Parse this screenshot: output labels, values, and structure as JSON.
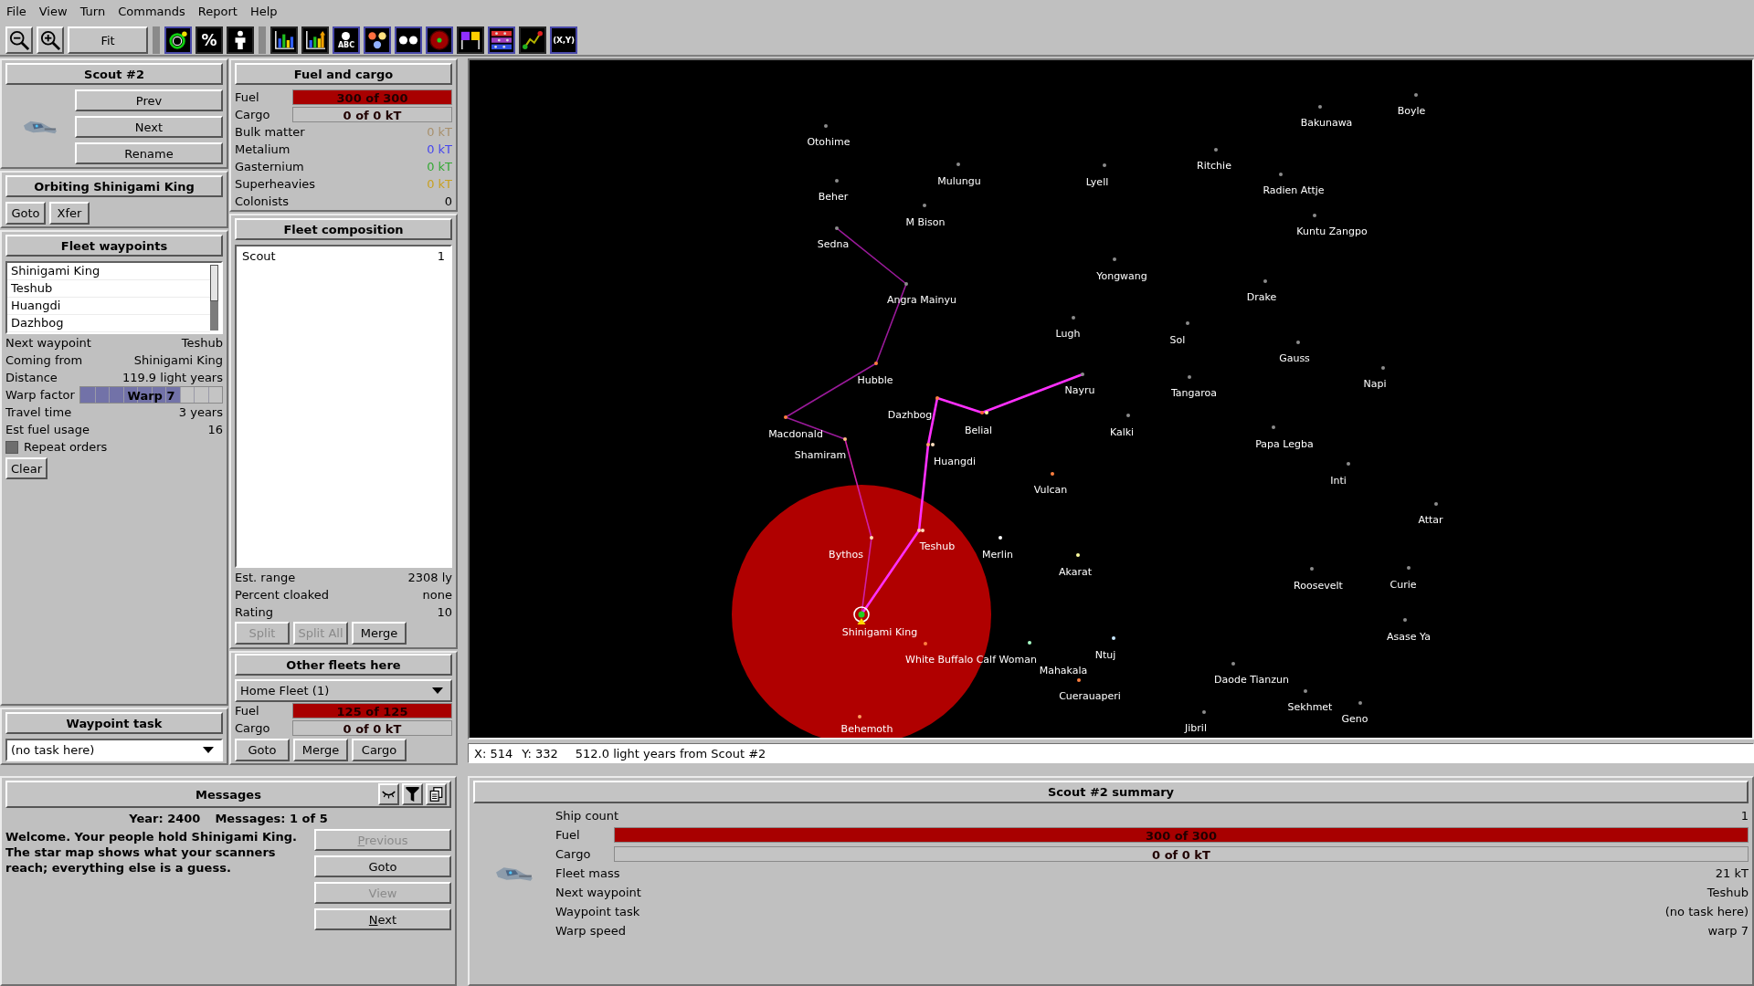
{
  "menu": [
    "File",
    "View",
    "Turn",
    "Commands",
    "Report",
    "Help"
  ],
  "toolbar": [
    {
      "kind": "zoom_out"
    },
    {
      "kind": "zoom_in"
    },
    {
      "kind": "fit",
      "label": "Fit"
    },
    {
      "kind": "separator"
    },
    {
      "kind": "planets",
      "on": true
    },
    {
      "kind": "percent",
      "label": "%",
      "on": false
    },
    {
      "kind": "person",
      "on": false
    },
    {
      "kind": "separator"
    },
    {
      "kind": "bars",
      "on": false
    },
    {
      "kind": "bars_up",
      "on": false
    },
    {
      "kind": "labels",
      "label": "ABC",
      "on": true
    },
    {
      "kind": "colors",
      "on": true
    },
    {
      "kind": "dots",
      "on": true
    },
    {
      "kind": "scanner",
      "on": true
    },
    {
      "kind": "flags",
      "on": false
    },
    {
      "kind": "lanes",
      "on": true
    },
    {
      "kind": "graph",
      "on": false
    },
    {
      "kind": "coords",
      "label": "(X,Y)",
      "on": true
    }
  ],
  "fleet": {
    "title": "Scout #2",
    "buttons": [
      "Prev",
      "Next",
      "Rename"
    ]
  },
  "location": {
    "title": "Orbiting Shinigami King",
    "buttons": [
      "Goto",
      "Xfer"
    ]
  },
  "waypoints": {
    "title": "Fleet waypoints",
    "items": [
      {
        "name": "Shinigami King",
        "selected": false
      },
      {
        "name": "Teshub",
        "selected": false
      },
      {
        "name": "Huangdi",
        "selected": false
      },
      {
        "name": "Dazhbog",
        "selected": false
      }
    ],
    "details": [
      {
        "kind": "text",
        "label": "Next waypoint",
        "value": "Teshub"
      },
      {
        "kind": "text",
        "label": "Coming from",
        "value": "Shinigami King"
      },
      {
        "kind": "text",
        "label": "Distance",
        "value": "119.9 light years"
      },
      {
        "kind": "slider",
        "label": "Warp factor",
        "value": "Warp 7",
        "level": 0.7
      },
      {
        "kind": "text",
        "label": "Travel time",
        "value": "3 years"
      },
      {
        "kind": "text",
        "label": "Est fuel usage",
        "value": "16"
      }
    ],
    "repeat": {
      "label": "Repeat orders",
      "checked": false
    },
    "clear": "Clear"
  },
  "waypoint_task": {
    "title": "Waypoint task",
    "value": "(no task here)"
  },
  "fuel_cargo": {
    "title": "Fuel and cargo",
    "bars": [
      {
        "label": "Fuel",
        "reading": "300 of 300",
        "level": 1
      },
      {
        "label": "Cargo",
        "reading": "0 of 0 kT",
        "level": 0
      }
    ],
    "items": [
      {
        "label": "Bulk matter",
        "value": "0 kT",
        "color": "#a8906c"
      },
      {
        "label": "Metalium",
        "value": "0 kT",
        "color": "#4444ee"
      },
      {
        "label": "Gasternium",
        "value": "0 kT",
        "color": "#33a833"
      },
      {
        "label": "Superheavies",
        "value": "0 kT",
        "color": "#c8a020"
      },
      {
        "label": "Colonists",
        "value": "0",
        "color": "#000000"
      }
    ]
  },
  "composition": {
    "title": "Fleet composition",
    "ships": [
      {
        "name": "Scout",
        "count": "1"
      }
    ],
    "stats": [
      {
        "label": "Est. range",
        "value": "2308 ly"
      },
      {
        "label": "Percent cloaked",
        "value": "none"
      },
      {
        "label": "Rating",
        "value": "10"
      }
    ],
    "buttons": [
      {
        "label": "Split",
        "disabled": true
      },
      {
        "label": "Split All",
        "disabled": true
      },
      {
        "label": "Merge",
        "disabled": false
      }
    ]
  },
  "other_fleets": {
    "title": "Other fleets here",
    "selection": "Home Fleet (1)",
    "bars": [
      {
        "label": "Fuel",
        "reading": "125 of 125",
        "level": 1
      },
      {
        "label": "Cargo",
        "reading": "0 of 0 kT",
        "level": 0
      }
    ],
    "buttons": [
      "Goto",
      "Merge",
      "Cargo"
    ]
  },
  "map": {
    "stars": [
      {
        "name": "Boyle",
        "color": "#8c8c8c",
        "selected": false
      },
      {
        "name": "Bakunawa",
        "color": "#8c8c8c",
        "selected": false
      },
      {
        "name": "Otohime",
        "color": "#8c8c8c",
        "selected": false
      },
      {
        "name": "Ritchie",
        "color": "#8c8c8c",
        "selected": false
      },
      {
        "name": "Mulungu",
        "color": "#8c8c8c",
        "selected": false
      },
      {
        "name": "Lyell",
        "color": "#8c8c8c",
        "selected": false
      },
      {
        "name": "Radien Attje",
        "color": "#8c8c8c",
        "selected": false
      },
      {
        "name": "Beher",
        "color": "#8c8c8c",
        "selected": false
      },
      {
        "name": "M Bison",
        "color": "#8c8c8c",
        "selected": false
      },
      {
        "name": "Kuntu Zangpo",
        "color": "#8c8c8c",
        "selected": false
      },
      {
        "name": "Sedna",
        "color": "#8c8c8c",
        "selected": false
      },
      {
        "name": "Yongwang",
        "color": "#8c8c8c",
        "selected": false
      },
      {
        "name": "Angra Mainyu",
        "color": "#8c8c8c",
        "selected": false
      },
      {
        "name": "Drake",
        "color": "#8c8c8c",
        "selected": false
      },
      {
        "name": "Lugh",
        "color": "#8c8c8c",
        "selected": false
      },
      {
        "name": "Sol",
        "color": "#8c8c8c",
        "selected": false
      },
      {
        "name": "Gauss",
        "color": "#8c8c8c",
        "selected": false
      },
      {
        "name": "Hubble",
        "color": "#ff7f3f",
        "selected": false
      },
      {
        "name": "Napi",
        "color": "#8c8c8c",
        "selected": false
      },
      {
        "name": "Nayru",
        "color": "#8c8c8c",
        "selected": false
      },
      {
        "name": "Tangaroa",
        "color": "#8c8c8c",
        "selected": false
      },
      {
        "name": "Dazhbog",
        "color": "#ff7f3f",
        "selected": false
      },
      {
        "name": "Macdonald",
        "color": "#ff7f3f",
        "selected": false
      },
      {
        "name": "Belial",
        "color": "#ff6030",
        "selected": false
      },
      {
        "name": "Kalki",
        "color": "#8c8c8c",
        "selected": false
      },
      {
        "name": "Papa Legba",
        "color": "#8c8c8c",
        "selected": false
      },
      {
        "name": "Shamiram",
        "color": "#ffc080",
        "selected": false
      },
      {
        "name": "Huangdi",
        "color": "#ff9f60",
        "selected": false
      },
      {
        "name": "Inti",
        "color": "#8c8c8c",
        "selected": false
      },
      {
        "name": "Vulcan",
        "color": "#ff7f3f",
        "selected": false
      },
      {
        "name": "Attar",
        "color": "#8c8c8c",
        "selected": false
      },
      {
        "name": "Teshub",
        "color": "#ffc8a0",
        "selected": false
      },
      {
        "name": "Bythos",
        "color": "#ffe0b0",
        "selected": false
      },
      {
        "name": "Merlin",
        "color": "#ffffff",
        "selected": false
      },
      {
        "name": "Akarat",
        "color": "#ffffa0",
        "selected": false
      },
      {
        "name": "Roosevelt",
        "color": "#8c8c8c",
        "selected": false
      },
      {
        "name": "Curie",
        "color": "#8c8c8c",
        "selected": false
      },
      {
        "name": "Shinigami King",
        "color": "#20d020",
        "selected": true
      },
      {
        "name": "Asase Ya",
        "color": "#8c8c8c",
        "selected": false
      },
      {
        "name": "White Buffalo Calf Woman",
        "color": "#ff7f3f",
        "selected": false
      },
      {
        "name": "Ntuj",
        "color": "#c8e8ff",
        "selected": false
      },
      {
        "name": "Mahakala",
        "color": "#a8ffc8",
        "selected": false
      },
      {
        "name": "Daode Tianzun",
        "color": "#8c8c8c",
        "selected": false
      },
      {
        "name": "Cuerauaperi",
        "color": "#ff7f3f",
        "selected": false
      },
      {
        "name": "Sekhmet",
        "color": "#8c8c8c",
        "selected": false
      },
      {
        "name": "Geno",
        "color": "#8c8c8c",
        "selected": false
      },
      {
        "name": "Behemoth",
        "color": "#ffa060",
        "selected": false
      },
      {
        "name": "Jibril",
        "color": "#8c8c8c",
        "selected": false
      }
    ],
    "status": [
      "X: 514",
      "Y: 332",
      "512.0 light years from Scout #2"
    ]
  },
  "messages": {
    "title": "Messages",
    "year": "Year: 2400",
    "count": "Messages: 1 of 5",
    "text": "Welcome. Your people hold Shinigami King. The star map shows what your scanners reach; everything else is a guess.",
    "buttons": [
      {
        "label": "Previous",
        "disabled": true,
        "mnemonic": true
      },
      {
        "label": "Goto",
        "disabled": false,
        "mnemonic": false
      },
      {
        "label": "View",
        "disabled": true,
        "mnemonic": false
      },
      {
        "label": "Next",
        "disabled": false,
        "mnemonic": true
      }
    ]
  },
  "summary": {
    "title": "Scout #2 summary",
    "rows": [
      {
        "kind": "text",
        "label": "Ship count",
        "value": "1"
      },
      {
        "kind": "bar",
        "label": "Fuel",
        "reading": "300 of 300",
        "level": 1
      },
      {
        "kind": "bar",
        "label": "Cargo",
        "reading": "0 of 0 kT",
        "level": 0
      },
      {
        "kind": "text",
        "label": "Fleet mass",
        "value": "21 kT"
      },
      {
        "kind": "text",
        "label": "Next waypoint",
        "value": "Teshub"
      },
      {
        "kind": "text",
        "label": "Waypoint task",
        "value": "(no task here)"
      },
      {
        "kind": "text",
        "label": "Warp speed",
        "value": "warp 7"
      }
    ]
  }
}
